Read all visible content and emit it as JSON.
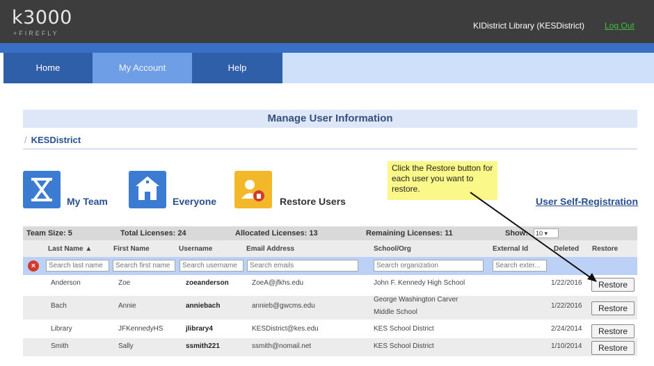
{
  "header": {
    "logo": "k3000",
    "logo_sub": "+FIREFLY",
    "district": "KIDistrict Library (KESDistrict)",
    "logout": "Log Out"
  },
  "nav": {
    "tabs": [
      "Home",
      "My Account",
      "Help"
    ]
  },
  "page": {
    "title": "Manage User Information",
    "breadcrumb": "KESDistrict",
    "actions": [
      "My Team",
      "Everyone",
      "Restore Users"
    ],
    "self_registration": "User Self-Registration",
    "callout": "Click the Restore button for each user you want to restore."
  },
  "summary": {
    "team_size": "Team Size: 5",
    "total": "Total Licenses: 24",
    "allocated": "Allocated Licenses: 13",
    "remaining": "Remaining Licenses: 11",
    "show_label": "Show:",
    "show_value": "10"
  },
  "columns": [
    "Last Name ▲",
    "First Name",
    "Username",
    "Email Address",
    "School/Org",
    "External Id",
    "Deleted",
    "Restore"
  ],
  "filters": {
    "last": "Search last name",
    "first": "Search first name",
    "user": "Search username",
    "email": "Search emails",
    "org": "Search organization",
    "ext": "Search exter..."
  },
  "rows": [
    {
      "last": "Anderson",
      "first": "Zoe",
      "user": "zoeanderson",
      "email": "ZoeA@jfkhs.edu",
      "org": "John F. Kennedy High School",
      "org2": "",
      "deleted": "1/22/2016",
      "btn": "Restore"
    },
    {
      "last": "Bach",
      "first": "Annie",
      "user": "anniebach",
      "email": "annieb@gwcms.edu",
      "org": "George Washington Carver",
      "org2": "Middle School",
      "deleted": "1/22/2016",
      "btn": "Restore"
    },
    {
      "last": "Library",
      "first": "JFKennedyHS",
      "user": "jlibrary4",
      "email": "KESDistrict@kes.edu",
      "org": "KES School District",
      "org2": "",
      "deleted": "2/24/2014",
      "btn": "Restore"
    },
    {
      "last": "Smith",
      "first": "Sally",
      "user": "ssmith221",
      "email": "ssmith@nomail.net",
      "org": "KES School District",
      "org2": "",
      "deleted": "1/10/2014",
      "btn": "Restore"
    }
  ],
  "colors": {
    "nav": "#2f5fa8",
    "nav_active": "#6e9ee6",
    "accent": "#3b7bd2",
    "restore_icon": "#f2b82a",
    "callout": "#fbf88a"
  }
}
